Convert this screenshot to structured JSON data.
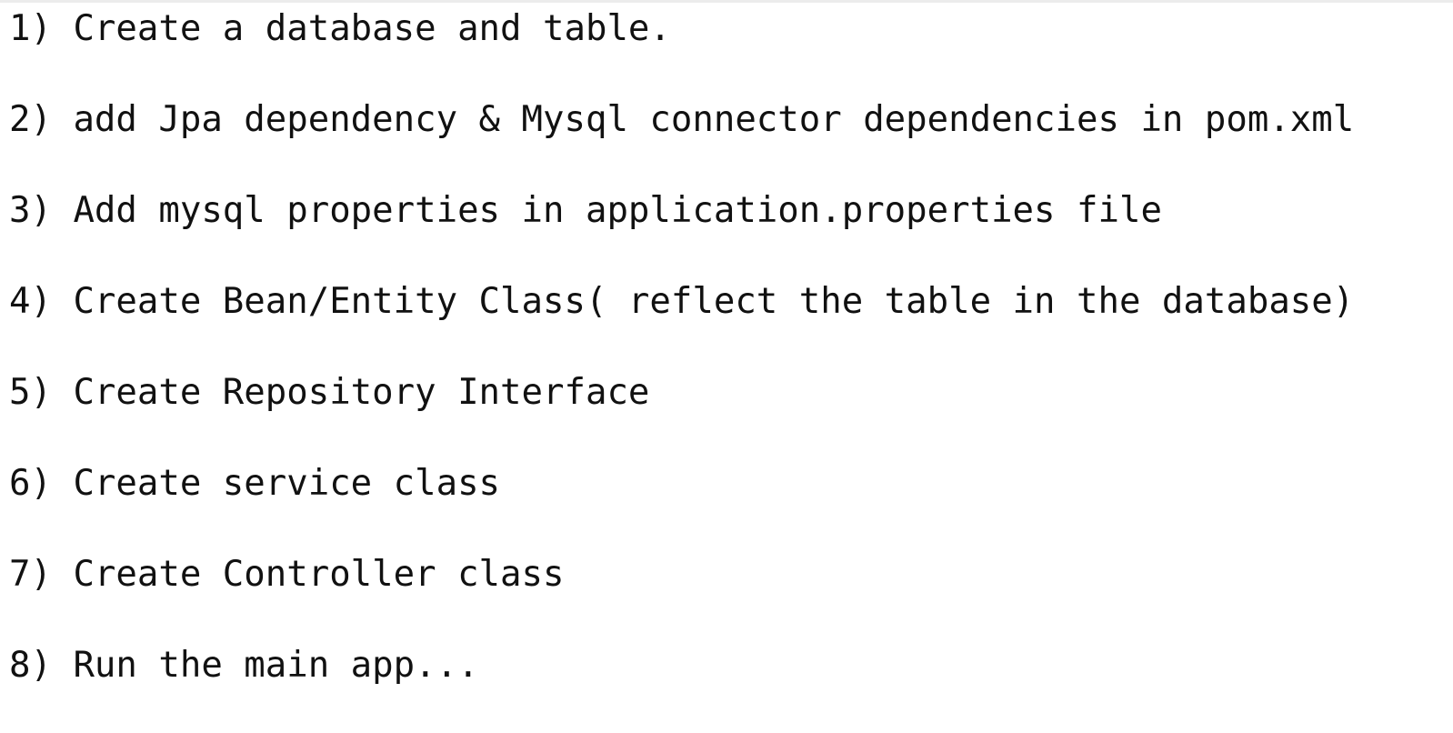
{
  "steps": [
    "1) Create a database and table.",
    "2) add Jpa dependency & Mysql connector dependencies in pom.xml",
    "3) Add mysql properties in application.properties file",
    "4) Create Bean/Entity Class( reflect the table in the database)",
    "5) Create Repository Interface",
    "6) Create service class",
    "7) Create Controller class",
    "8) Run the main app..."
  ]
}
